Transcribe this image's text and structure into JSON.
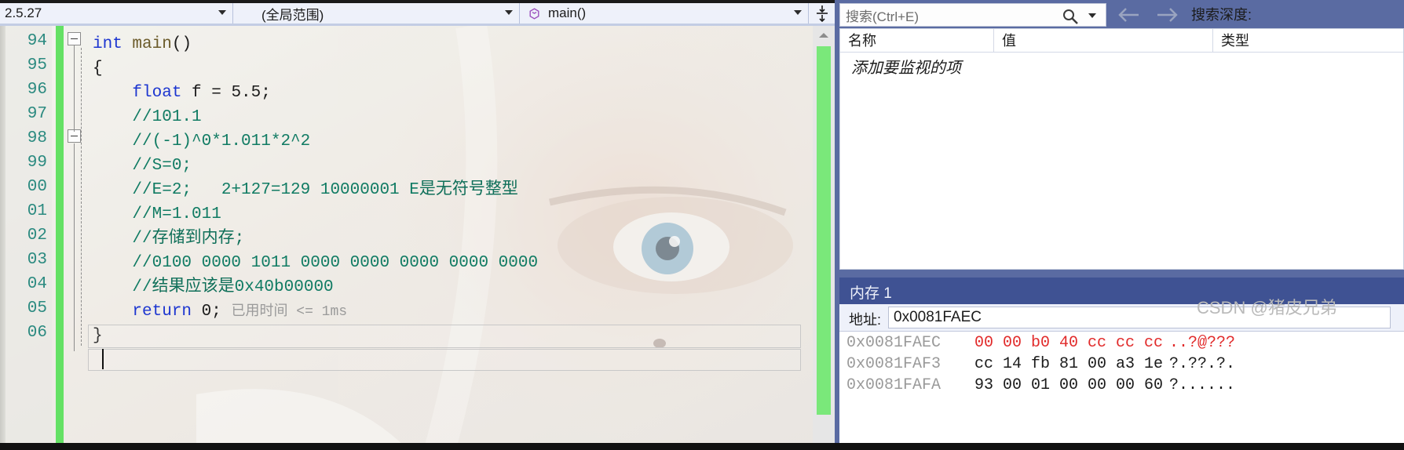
{
  "navbar": {
    "scope_file": "2.5.27",
    "scope_global": "(全局范围)",
    "scope_member": "main()",
    "member_icon": "method-icon",
    "split_icon": "split-window-icon"
  },
  "editor": {
    "lines": [
      {
        "num": "94",
        "segments": [
          {
            "t": "int ",
            "c": "kw"
          },
          {
            "t": "main",
            "c": "fn"
          },
          {
            "t": "()",
            "c": "plain"
          }
        ]
      },
      {
        "num": "95",
        "segments": [
          {
            "t": "{",
            "c": "plain"
          }
        ]
      },
      {
        "num": "96",
        "segments": [
          {
            "t": "    ",
            "c": "plain"
          },
          {
            "t": "float",
            "c": "kw"
          },
          {
            "t": " f = 5.5;",
            "c": "plain"
          }
        ]
      },
      {
        "num": "97",
        "segments": [
          {
            "t": "    //101.1",
            "c": "cmt"
          }
        ]
      },
      {
        "num": "98",
        "segments": [
          {
            "t": "    //(-1)^0*1.011*2^2",
            "c": "cmt"
          }
        ]
      },
      {
        "num": "99",
        "segments": [
          {
            "t": "    //S=0;",
            "c": "cmt"
          }
        ]
      },
      {
        "num": "00",
        "segments": [
          {
            "t": "    //E=2;   2+127=129 10000001 E",
            "c": "cmt"
          },
          {
            "t": "是无符号整型",
            "c": "cmt-cn"
          }
        ]
      },
      {
        "num": "01",
        "segments": [
          {
            "t": "    //M=1.011",
            "c": "cmt"
          }
        ]
      },
      {
        "num": "02",
        "segments": [
          {
            "t": "    //",
            "c": "cmt"
          },
          {
            "t": "存储到内存;",
            "c": "cmt-cn"
          }
        ]
      },
      {
        "num": "03",
        "segments": [
          {
            "t": "    //0100 0000 1011 0000 0000 0000 0000 0000",
            "c": "cmt"
          }
        ]
      },
      {
        "num": "04",
        "segments": [
          {
            "t": "    //",
            "c": "cmt"
          },
          {
            "t": "结果应该是",
            "c": "cmt-cn"
          },
          {
            "t": "0x40b00000",
            "c": "cmt"
          }
        ]
      },
      {
        "num": "05",
        "segments": [
          {
            "t": "    ",
            "c": "plain"
          },
          {
            "t": "return",
            "c": "kw"
          },
          {
            "t": " 0; ",
            "c": "plain"
          },
          {
            "t": "已用时间 <= 1ms",
            "c": "hint"
          }
        ]
      },
      {
        "num": "06",
        "segments": [
          {
            "t": "}",
            "c": "plain"
          }
        ]
      }
    ]
  },
  "search": {
    "placeholder": "搜索(Ctrl+E)",
    "magnifier_icon": "search-icon",
    "dropdown_icon": "chevron-down-icon",
    "back_icon": "arrow-left-icon",
    "forward_icon": "arrow-right-icon",
    "depth_label": "搜索深度:"
  },
  "watch": {
    "columns": [
      "名称",
      "值",
      "类型"
    ],
    "placeholder_row": "添加要监视的项"
  },
  "memory": {
    "title": "内存 1",
    "address_label": "地址:",
    "address_value": "0x0081FAEC",
    "rows": [
      {
        "addr": "0x0081FAEC",
        "hex": "00 00 b0 40 cc cc cc",
        "hex_changed": true,
        "ascii": "..?@???",
        "ascii_changed": true
      },
      {
        "addr": "0x0081FAF3",
        "hex": "cc 14 fb 81 00 a3 1e",
        "hex_changed": false,
        "ascii": "?.??.?.",
        "ascii_changed": false
      },
      {
        "addr": "0x0081FAFA",
        "hex": "93 00 01 00 00 00 60",
        "hex_changed": false,
        "ascii": "?......",
        "ascii_changed": false
      }
    ],
    "watermark": "CSDN @猪皮兄弟"
  },
  "colors": {
    "keyword": "#1d36d0",
    "comment": "#107b63",
    "line_number": "#2b8a80",
    "change_bar": "#64e164",
    "panel_blue": "#5a6ba2",
    "title_blue": "#3f5293",
    "changed_byte": "#e12a2a"
  }
}
